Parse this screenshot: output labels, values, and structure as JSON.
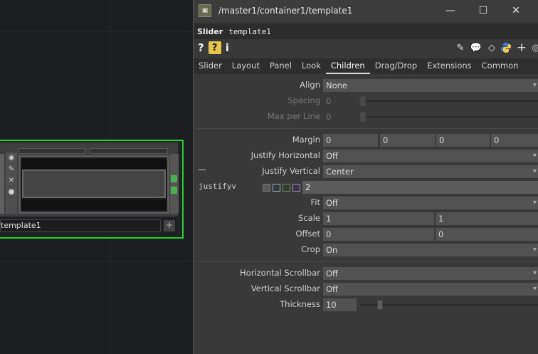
{
  "network": {
    "node_name": "template1"
  },
  "window": {
    "title": "/master1/container1/template1",
    "minimize": "—",
    "maximize": "☐",
    "close": "✕"
  },
  "operator": {
    "type": "Slider",
    "name": "template1"
  },
  "toolbar": {
    "help": "?",
    "help_python": "?",
    "info": "i"
  },
  "tabs": [
    "Slider",
    "Layout",
    "Panel",
    "Look",
    "Children",
    "Drag/Drop",
    "Extensions",
    "Common"
  ],
  "active_tab": "Children",
  "params": {
    "align": {
      "label": "Align",
      "value": "None"
    },
    "spacing": {
      "label": "Spacing",
      "value": "0"
    },
    "max_per_line": {
      "label": "Max per Line",
      "value": "0"
    },
    "margin": {
      "label": "Margin",
      "values": [
        "0",
        "0",
        "0",
        "0"
      ]
    },
    "justify_horizontal": {
      "label": "Justify Horizontal",
      "value": "Off"
    },
    "justify_vertical": {
      "label": "Justify Vertical",
      "value": "Center",
      "collapse": "—"
    },
    "justifyv_expr": {
      "name": "justifyv",
      "value": "2"
    },
    "fit": {
      "label": "Fit",
      "value": "Off"
    },
    "scale": {
      "label": "Scale",
      "values": [
        "1",
        "1"
      ]
    },
    "offset": {
      "label": "Offset",
      "values": [
        "0",
        "0"
      ]
    },
    "crop": {
      "label": "Crop",
      "value": "On"
    },
    "horizontal_scrollbar": {
      "label": "Horizontal Scrollbar",
      "value": "Off"
    },
    "vertical_scrollbar": {
      "label": "Vertical Scrollbar",
      "value": "Off"
    },
    "thickness": {
      "label": "Thickness",
      "value": "10"
    }
  },
  "colors": {
    "node_outline": "#22d42a",
    "python_icon": "#3c78d8",
    "help_yellow": "#e8c64a"
  }
}
